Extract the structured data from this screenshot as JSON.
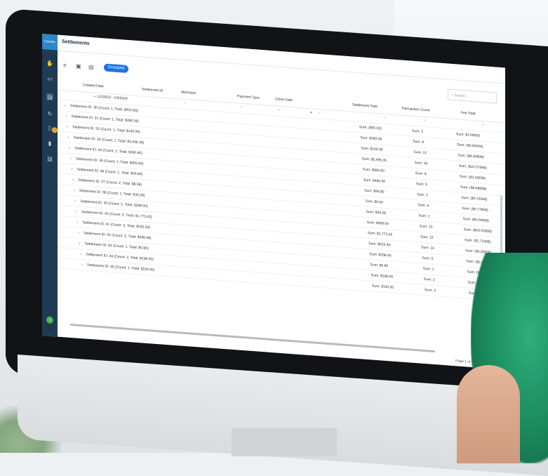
{
  "app": {
    "logo_text": "Cemex",
    "page_title": "Settlements"
  },
  "toolbar": {
    "grouped_label": "Grouped",
    "search_placeholder": "Search..."
  },
  "grid": {
    "headers": [
      "Created Date",
      "Settlement ID",
      "Merchant",
      "Payment Type",
      "Close Date",
      "Settlement Total",
      "Transaction Count",
      "Fee Total"
    ],
    "group_label": "1/2/2023 - 1/9/2024",
    "rows": [
      {
        "label": "Settlement ID: 30 (Count: 1, Total: ($55.03))",
        "total": "Sum: ($55.03)",
        "count": "Sum: 3",
        "fee": "Sum: $3.09059"
      },
      {
        "label": "Settlement ID: 31 (Count: 1, Total: $280.06)",
        "total": "Sum: $280.06",
        "count": "Sum: 8",
        "fee": "Sum: ($0.60696)"
      },
      {
        "label": "Settlement ID: 32 (Count: 1, Total: $149.90)",
        "total": "Sum: $149.90",
        "count": "Sum: 12",
        "fee": "Sum: ($4.80898)"
      },
      {
        "label": "Settlement ID: 33 (Count: 1, Total: $5,496.35)",
        "total": "Sum: $5,496.35",
        "count": "Sum: 18",
        "fee": "Sum: ($22.97068)"
      },
      {
        "label": "Settlement ID: 34 (Count: 1, Total: $360.60)",
        "total": "Sum: $360.60",
        "count": "Sum: 8",
        "fee": "Sum: ($3.16838)"
      },
      {
        "label": "Settlement ID: 35 (Count: 1, Total: $460.60)",
        "total": "Sum: $460.60",
        "count": "Sum: 9",
        "fee": "Sum: ($6.68808)"
      },
      {
        "label": "Settlement ID: 36 (Count: 1, Total: $90.80)",
        "total": "Sum: $90.80",
        "count": "Sum: 1",
        "fee": "Sum: ($0.72568)"
      },
      {
        "label": "Settlement ID: 37 (Count: 2, Total: $8.08)",
        "total": "Sum: $0.60",
        "count": "Sum: 4",
        "fee": "Sum: ($0.77808)"
      },
      {
        "label": "Settlement ID: 38 (Count: 1, Total: $39.28)",
        "total": "Sum: $39.28",
        "count": "Sum: 1",
        "fee": "Sum: ($0.04808)"
      },
      {
        "label": "Settlement ID: 39 (Count: 1, Total: $398.00)",
        "total": "Sum: $398.00",
        "count": "Sum: 13",
        "fee": "Sum: ($03.02808)"
      },
      {
        "label": "Settlement ID: 40 (Count: 3, Total: $1,773.42)",
        "total": "Sum: $1,773.42",
        "count": "Sum: 15",
        "fee": "Sum: ($1.71508)"
      },
      {
        "label": "Settlement ID: 41 (Count: 3, Total: $525.54)",
        "total": "Sum: $525.94",
        "count": "Sum: 16",
        "fee": "Sum: ($0.20508)"
      },
      {
        "label": "Settlement ID: 42 (Count: 3, Total: $298.98)",
        "total": "Sum: $298.90",
        "count": "Sum: 5",
        "fee": "Sum: ($2.06082)"
      },
      {
        "label": "Settlement ID: 43 (Count: 1, Total: $0.80)",
        "total": "Sum: $0.80",
        "count": "Sum: 1",
        "fee": "Sum: ($40.41408)"
      },
      {
        "label": "Settlement ID: 44 (Count: 2, Total: $198.99)",
        "total": "Sum: $198.99",
        "count": "Sum: 2",
        "fee": "Sum: ($1.61282)"
      },
      {
        "label": "Settlement ID: 45 (Count: 1, Total: $100.00)",
        "total": "Sum: $100.00",
        "count": "Sum: 3",
        "fee": "Sum: ($0.10588)"
      }
    ],
    "pager_text": "Page 1 of 1 (16 items)",
    "current_page": "1",
    "page_size": "50"
  },
  "user": {
    "initial": "J"
  }
}
